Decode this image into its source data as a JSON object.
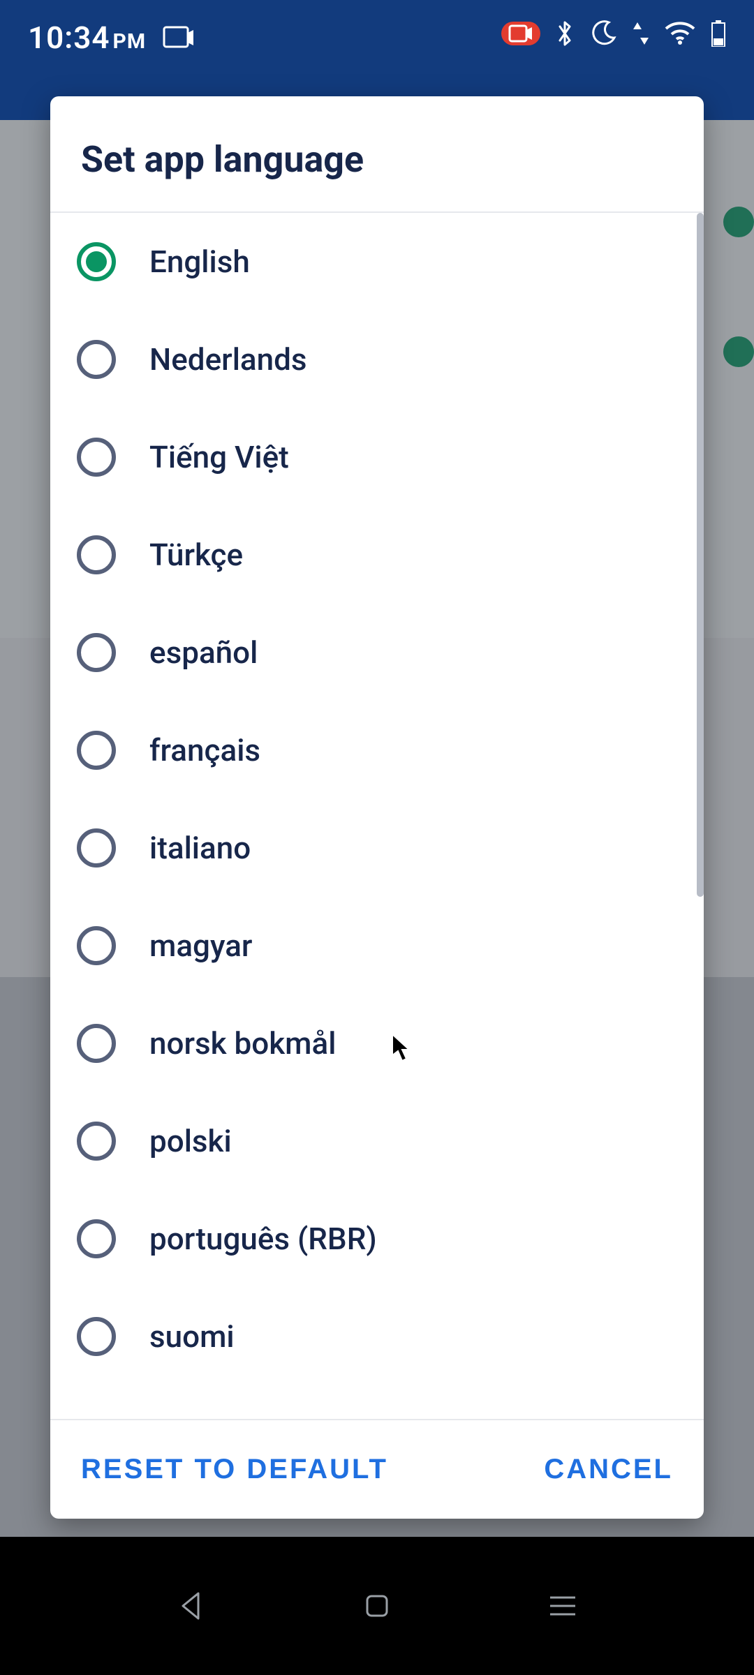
{
  "statusbar": {
    "time": "10:34",
    "time_suffix": "PM",
    "icons": [
      "screencast-icon",
      "record-icon",
      "bluetooth-icon",
      "dnd-moon-icon",
      "data-updown-icon",
      "wifi-icon",
      "battery-icon"
    ]
  },
  "dialog": {
    "title": "Set app language",
    "options": [
      {
        "label": "English",
        "selected": true
      },
      {
        "label": "Nederlands",
        "selected": false
      },
      {
        "label": "Tiếng Việt",
        "selected": false
      },
      {
        "label": "Türkçe",
        "selected": false
      },
      {
        "label": "español",
        "selected": false
      },
      {
        "label": "français",
        "selected": false
      },
      {
        "label": "italiano",
        "selected": false
      },
      {
        "label": "magyar",
        "selected": false
      },
      {
        "label": "norsk bokmål",
        "selected": false
      },
      {
        "label": "polski",
        "selected": false
      },
      {
        "label": "português (RBR)",
        "selected": false
      },
      {
        "label": "suomi",
        "selected": false
      }
    ],
    "actions": {
      "reset": "RESET TO DEFAULT",
      "cancel": "CANCEL"
    }
  },
  "colors": {
    "primary_header": "#123b7d",
    "accent_green": "#0a9563",
    "action_blue": "#1f6fe0",
    "text_dark": "#17264a",
    "radio_border": "#56607a"
  }
}
